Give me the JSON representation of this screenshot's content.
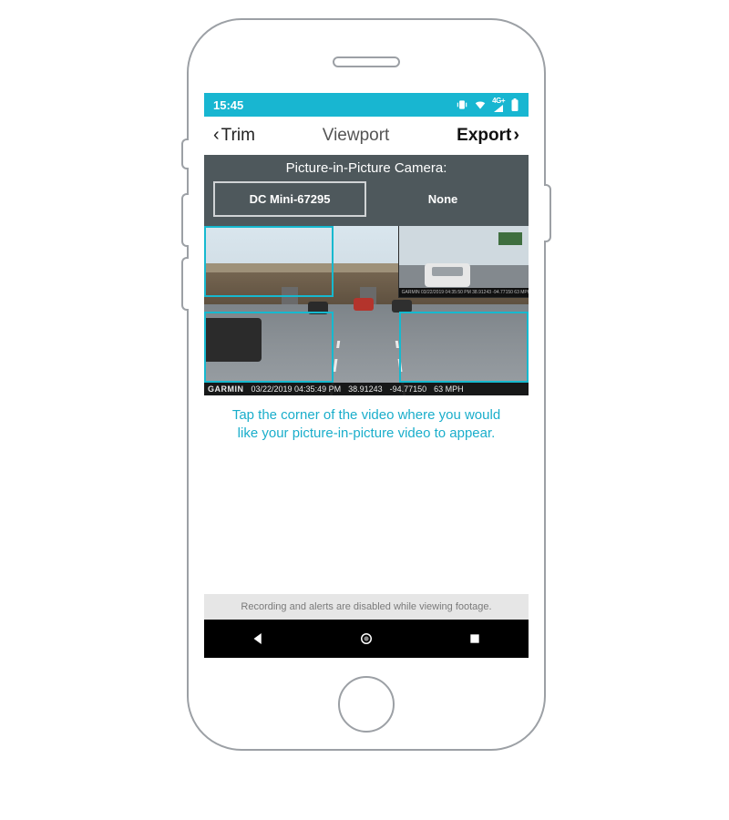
{
  "status": {
    "time": "15:45",
    "network_label": "4G+"
  },
  "header": {
    "back_label": "Trim",
    "title": "Viewport",
    "forward_label": "Export"
  },
  "pip": {
    "title": "Picture-in-Picture Camera:",
    "options": [
      "DC Mini-67295",
      "None"
    ],
    "selected_index": 0
  },
  "overlay": {
    "brand": "GARMIN",
    "datetime": "03/22/2019 04:35:49 PM",
    "lat": "38.91243",
    "lon": "-94.77150",
    "speed": "63 MPH",
    "pip_strip": "GARMIN 03/22/2019 04:35:50 PM 38.91243 -94.77150 63 MPH"
  },
  "hint": "Tap the corner of the video where you would like your picture-in-picture video to appear.",
  "notice": "Recording and alerts are disabled while viewing footage."
}
